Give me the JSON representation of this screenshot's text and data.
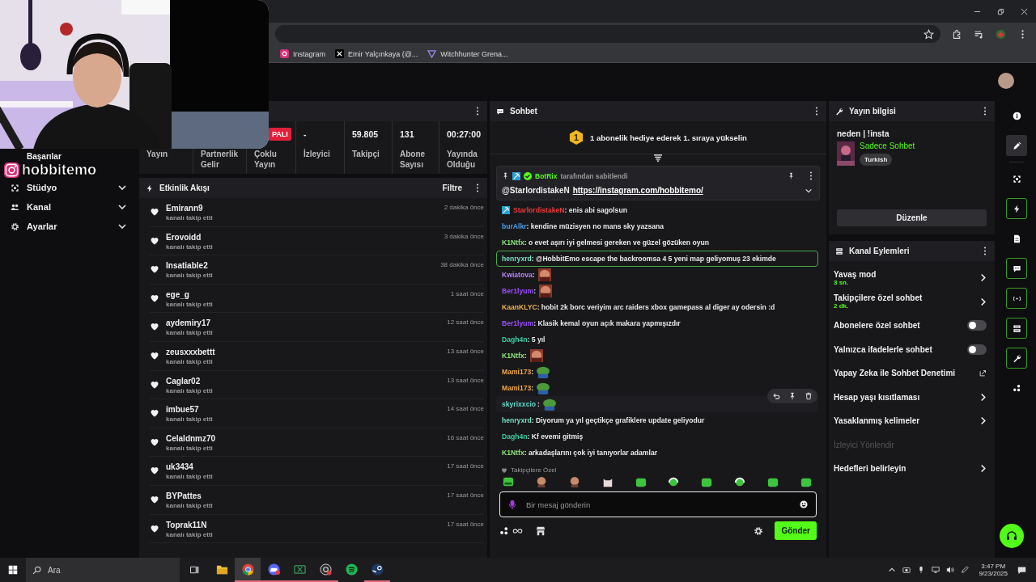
{
  "browser": {
    "bookmarks": [
      "Instagram",
      "Emir Yalçınkaya (@...",
      "Witchhunter Grena..."
    ]
  },
  "webcam": {
    "kind": "picture",
    "channel": "hobbitemo"
  },
  "sidebar": {
    "items": [
      {
        "label": "Başarılar",
        "kind": "link"
      },
      {
        "label": "Stüdyo",
        "kind": "group"
      },
      {
        "label": "Kanal",
        "kind": "group"
      },
      {
        "label": "Ayarlar",
        "kind": "group"
      }
    ]
  },
  "stats": {
    "cells": [
      {
        "label": "Yayın"
      },
      {
        "label": "Partnerlik Gelir"
      },
      {
        "badge": "PALI",
        "label": "Çoklu Yayın"
      },
      {
        "value": "-",
        "label": "İzleyici"
      },
      {
        "value": "59.805",
        "label": "Takipçi"
      },
      {
        "value": "131",
        "label": "Abone Sayısı"
      },
      {
        "value": "00:27:00",
        "label": "Yayında Olduğu"
      }
    ]
  },
  "events": {
    "title": "Etkinlik Akışı",
    "filter": "Filtre",
    "items": [
      {
        "user": "Emirann9",
        "action": "kanalı takip etti",
        "time": "2 dakika önce"
      },
      {
        "user": "Erovoidd",
        "action": "kanalı takip etti",
        "time": "3 dakika önce"
      },
      {
        "user": "Insatiable2",
        "action": "kanalı takip etti",
        "time": "38 dakika önce"
      },
      {
        "user": "ege_g",
        "action": "kanalı takip etti",
        "time": "1 saat önce"
      },
      {
        "user": "aydemiry17",
        "action": "kanalı takip etti",
        "time": "12 saat önce"
      },
      {
        "user": "zeusxxxbettt",
        "action": "kanalı takip etti",
        "time": "13 saat önce"
      },
      {
        "user": "Caglar02",
        "action": "kanalı takip etti",
        "time": "13 saat önce"
      },
      {
        "user": "imbue57",
        "action": "kanalı takip etti",
        "time": "14 saat önce"
      },
      {
        "user": "Celaldnmz70",
        "action": "kanalı takip etti",
        "time": "16 saat önce"
      },
      {
        "user": "uk3434",
        "action": "kanalı takip etti",
        "time": "17 saat önce"
      },
      {
        "user": "BYPattes",
        "action": "kanalı takip etti",
        "time": "17 saat önce"
      },
      {
        "user": "Toprak11N",
        "action": "kanalı takip etti",
        "time": "17 saat önce"
      }
    ]
  },
  "chat": {
    "title": "Sohbet",
    "banner": {
      "rank": "1",
      "text": "1 abonelik hediye ederek 1. sıraya yükselin"
    },
    "pinned": {
      "by": "BotRix",
      "note": "tarafından sabitlendi",
      "mention": "@StarlordistakeN",
      "link": "https://instagram.com/hobbitemo/"
    },
    "messages": [
      {
        "user": "StarlordistakeN",
        "color": "#eb3b3b",
        "badge": true,
        "text": ": enis abi sagolsun",
        "highlighted": false,
        "hovered": false
      },
      {
        "user": "burAlkr",
        "color": "#4a9fe8",
        "badge": false,
        "text": ": kendine müzisyen no mans sky yazsana",
        "highlighted": false,
        "hovered": false
      },
      {
        "user": "K1Ntfx",
        "color": "#8ae67a",
        "badge": false,
        "text": ": o evet aşırı iyi gelmesi gereken ve güzel gözüken oyun",
        "highlighted": false,
        "hovered": false
      },
      {
        "user": "henryxrd",
        "color": "#77dfc0",
        "badge": false,
        "text": ": @HobbitEmo escape the backroomsa 4 5 yeni map geliyomuş 23 ekimde",
        "highlighted": true,
        "hovered": false
      },
      {
        "user": "Kwiatova",
        "color": "#b784f5",
        "badge": false,
        "text": ":",
        "kind": "face",
        "highlighted": false,
        "hovered": false
      },
      {
        "user": "Ber1lyum",
        "color": "#9b4dff",
        "badge": false,
        "text": ":",
        "kind": "face",
        "highlighted": false,
        "hovered": false
      },
      {
        "user": "KaanKLYC",
        "color": "#f0b34a",
        "badge": false,
        "text": ": hobit 2k borc veriyim arc raiders xbox gamepass al diger ay odersin :d",
        "highlighted": false,
        "hovered": false
      },
      {
        "user": "Ber1lyum",
        "color": "#9b4dff",
        "badge": false,
        "text": ": Klasik kemal oyun açık makara yapmışızdır",
        "highlighted": false,
        "hovered": false
      },
      {
        "user": "Dagh4n",
        "color": "#3ccfa0",
        "badge": false,
        "text": ": 5 yıl",
        "highlighted": false,
        "hovered": false
      },
      {
        "user": "K1Ntfx",
        "color": "#8ae67a",
        "badge": false,
        "text": ":",
        "kind": "face",
        "highlighted": false,
        "hovered": false
      },
      {
        "user": "Mami173",
        "color": "#f2a644",
        "badge": false,
        "text": ":",
        "kind": "frog",
        "highlighted": false,
        "hovered": false
      },
      {
        "user": "Mami173",
        "color": "#f2a644",
        "badge": false,
        "text": ":",
        "kind": "frog",
        "highlighted": false,
        "hovered": false
      },
      {
        "user": "skyrixxcio",
        "color": "#5ed6c8",
        "badge": false,
        "text": ":",
        "kind": "frog",
        "highlighted": false,
        "hovered": true
      },
      {
        "user": "henryxrd",
        "color": "#77dfc0",
        "badge": false,
        "text": ": Diyorum ya yıl geçtikçe grafiklere update geliyodur",
        "highlighted": false,
        "hovered": false
      },
      {
        "user": "Dagh4n",
        "color": "#3ccfa0",
        "badge": false,
        "text": ": Kf evemi gitmiş",
        "highlighted": false,
        "hovered": false
      },
      {
        "user": "K1Ntfx",
        "color": "#8ae67a",
        "badge": false,
        "text": ": arkadaşlarını çok iyi tanıyorlar adamlar",
        "highlighted": false,
        "hovered": false
      }
    ],
    "emote_section": "Takipçilere Özel",
    "emotes": [
      {
        "kind": "frog"
      },
      {
        "kind": "face"
      },
      {
        "kind": "face"
      },
      {
        "kind": "cat"
      },
      {
        "kind": "blob"
      },
      {
        "kind": "dj"
      },
      {
        "kind": "blob"
      },
      {
        "kind": "dj"
      },
      {
        "kind": "blob"
      },
      {
        "kind": "blob"
      }
    ],
    "placeholder": "Bir mesaj gönderin",
    "send": "Gönder"
  },
  "info": {
    "title": "Yayın bilgisi",
    "stream_title": "neden | !insta",
    "category": "Sadece Sohbet",
    "tag": "Turkish",
    "edit": "Düzenle"
  },
  "actions": {
    "title": "Kanal Eylemleri",
    "items": [
      {
        "kind": "link",
        "label": "Yavaş mod",
        "value": "3 sn."
      },
      {
        "kind": "link",
        "label": "Takipçilere özel sohbet",
        "value": "2 dk."
      },
      {
        "kind": "toggle",
        "label": "Abonelere özel sohbet",
        "on": false
      },
      {
        "kind": "toggle",
        "label": "Yalnızca ifadelerle sohbet",
        "on": false
      },
      {
        "kind": "external",
        "label": "Yapay Zeka ile Sohbet Denetimi"
      },
      {
        "kind": "link",
        "label": "Hesap yaşı kısıtlaması"
      },
      {
        "kind": "link",
        "label": "Yasaklanmış kelimeler"
      },
      {
        "kind": "disabled",
        "label": "İzleyici Yönlendir"
      },
      {
        "kind": "link",
        "label": "Hedefleri belirleyin"
      }
    ]
  },
  "rail": [
    {
      "selected": false,
      "active": false
    },
    {
      "selected": true,
      "active": false
    },
    {
      "selected": false,
      "active": false
    },
    {
      "selected": false,
      "active": true
    },
    {
      "selected": false,
      "active": false
    },
    {
      "selected": false,
      "active": true
    },
    {
      "selected": false,
      "active": true
    },
    {
      "selected": false,
      "active": true
    },
    {
      "selected": false,
      "active": true
    },
    {
      "selected": false,
      "active": false
    }
  ],
  "taskbar": {
    "search": "Ara",
    "apps": [
      {
        "running": false,
        "selected": false
      },
      {
        "running": true,
        "selected": true
      },
      {
        "running": true,
        "selected": false
      },
      {
        "running": true,
        "selected": false
      },
      {
        "running": true,
        "selected": false
      },
      {
        "running": false,
        "selected": false
      },
      {
        "running": true,
        "selected": false
      }
    ],
    "time": "3:47 PM",
    "date": "9/23/2025"
  }
}
